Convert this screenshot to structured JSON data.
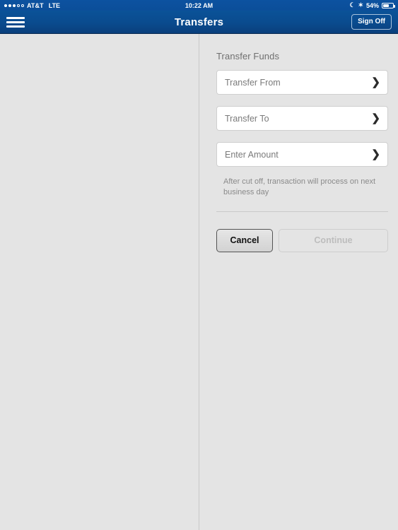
{
  "statusbar": {
    "carrier": "AT&T",
    "network": "LTE",
    "time": "10:22 AM",
    "battery_percent": "54%",
    "signal_dots_filled": 3,
    "signal_dots_total": 5,
    "moon_icon": "do-not-disturb-icon",
    "bluetooth_icon": "bluetooth-icon",
    "bluetooth_glyph": "✶",
    "moon_glyph": "☾"
  },
  "navbar": {
    "menu_icon": "hamburger-menu-icon",
    "title": "Transfers",
    "signoff_label": "Sign Off",
    "background_color": "#0a4b8e"
  },
  "detail": {
    "section_title": "Transfer Funds",
    "fields": [
      {
        "label": "Transfer From",
        "value": "",
        "chevron": "❯"
      },
      {
        "label": "Transfer To",
        "value": "",
        "chevron": "❯"
      },
      {
        "label": "Enter Amount",
        "value": "",
        "chevron": "❯"
      }
    ],
    "hint": "After cut off, transaction will process on next business day",
    "buttons": {
      "cancel_label": "Cancel",
      "continue_label": "Continue",
      "continue_disabled": true
    }
  },
  "colors": {
    "page_background": "#e4e4e4",
    "field_background": "#ffffff",
    "field_border": "#cfcfcf",
    "placeholder_text": "#7a7a7a",
    "hint_text": "#8a8a8a"
  }
}
